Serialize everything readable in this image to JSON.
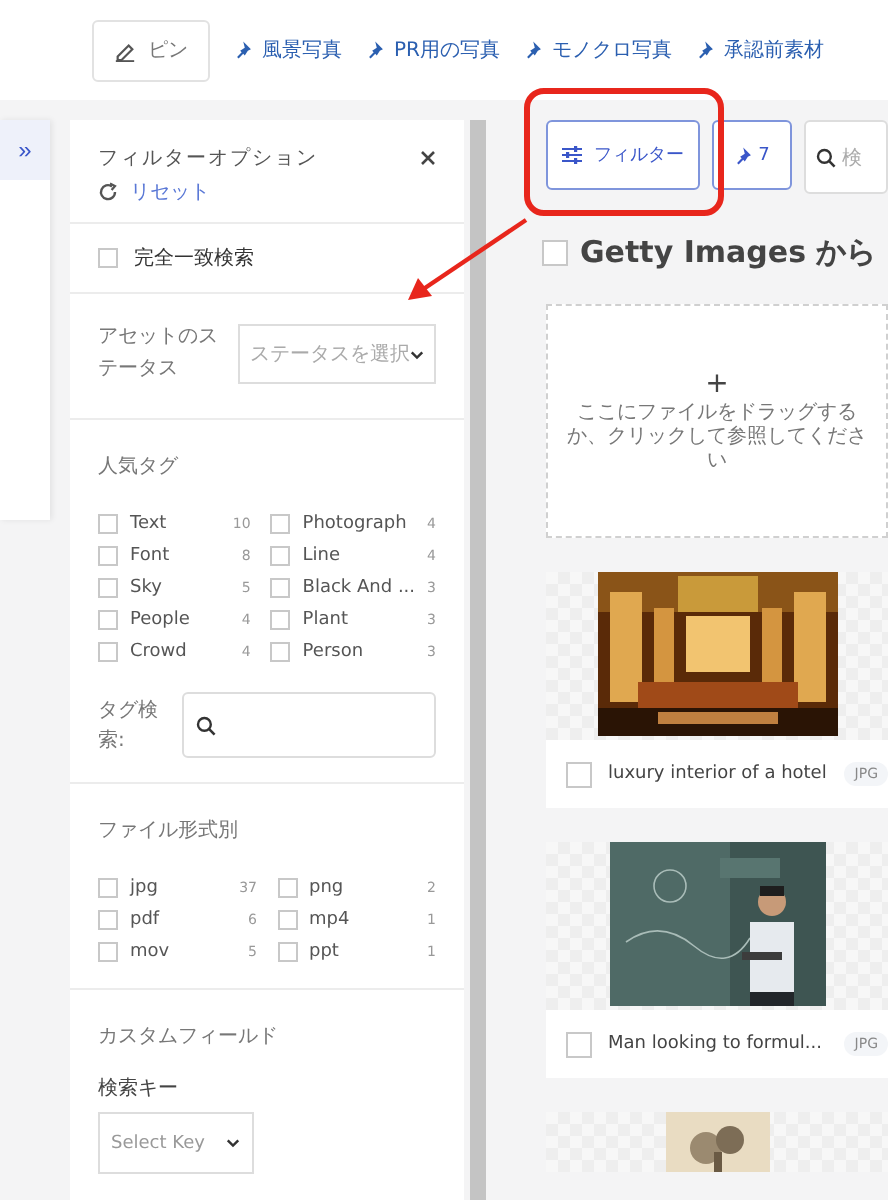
{
  "sidebar": {
    "expand": "»"
  },
  "top_tabs": [
    {
      "kind": "edit",
      "label": "ピン"
    },
    {
      "kind": "pin",
      "label": "風景写真"
    },
    {
      "kind": "pin",
      "label": "PR用の写真"
    },
    {
      "kind": "pin",
      "label": "モノクロ写真"
    },
    {
      "kind": "pin",
      "label": "承認前素材"
    }
  ],
  "filter_panel": {
    "title": "フィルターオプション",
    "reset": "リセット",
    "exact_match": {
      "label": "完全一致検索",
      "checked": false
    },
    "status": {
      "label": "アセットのステータス",
      "placeholder": "ステータスを選択"
    },
    "popular_tags": {
      "title": "人気タグ",
      "items": [
        {
          "label": "Text",
          "count": "10",
          "checked": false
        },
        {
          "label": "Photograph",
          "count": "4",
          "checked": false
        },
        {
          "label": "Font",
          "count": "8",
          "checked": false
        },
        {
          "label": "Line",
          "count": "4",
          "checked": false
        },
        {
          "label": "Sky",
          "count": "5",
          "checked": false
        },
        {
          "label": "Black And ...",
          "count": "3",
          "checked": false
        },
        {
          "label": "People",
          "count": "4",
          "checked": false
        },
        {
          "label": "Plant",
          "count": "3",
          "checked": false
        },
        {
          "label": "Crowd",
          "count": "4",
          "checked": false
        },
        {
          "label": "Person",
          "count": "3",
          "checked": false
        }
      ],
      "search_label": "タグ検索:"
    },
    "file_types": {
      "title": "ファイル形式別",
      "items": [
        {
          "label": "jpg",
          "count": "37",
          "checked": false
        },
        {
          "label": "png",
          "count": "2",
          "checked": false
        },
        {
          "label": "pdf",
          "count": "6",
          "checked": false
        },
        {
          "label": "mp4",
          "count": "1",
          "checked": false
        },
        {
          "label": "mov",
          "count": "5",
          "checked": false
        },
        {
          "label": "ppt",
          "count": "1",
          "checked": false
        }
      ]
    },
    "custom_fields": {
      "title": "カスタムフィールド",
      "key_label": "検索キー",
      "key_placeholder": "Select Key"
    }
  },
  "toolbar": {
    "filter_button": "フィルター",
    "pin_count": "7",
    "search_placeholder": "検"
  },
  "content": {
    "title": "Getty Images から",
    "title_checked": false,
    "drop_plus": "+",
    "drop_hint": "ここにファイルをドラッグするか、クリックして参照してください",
    "assets": [
      {
        "kind": "hotel",
        "name": "luxury interior of a hotel",
        "type": "JPG",
        "checked": false
      },
      {
        "kind": "chalkboard",
        "name": "Man looking to formul...",
        "type": "JPG",
        "checked": false
      },
      {
        "kind": "sketch"
      }
    ]
  }
}
